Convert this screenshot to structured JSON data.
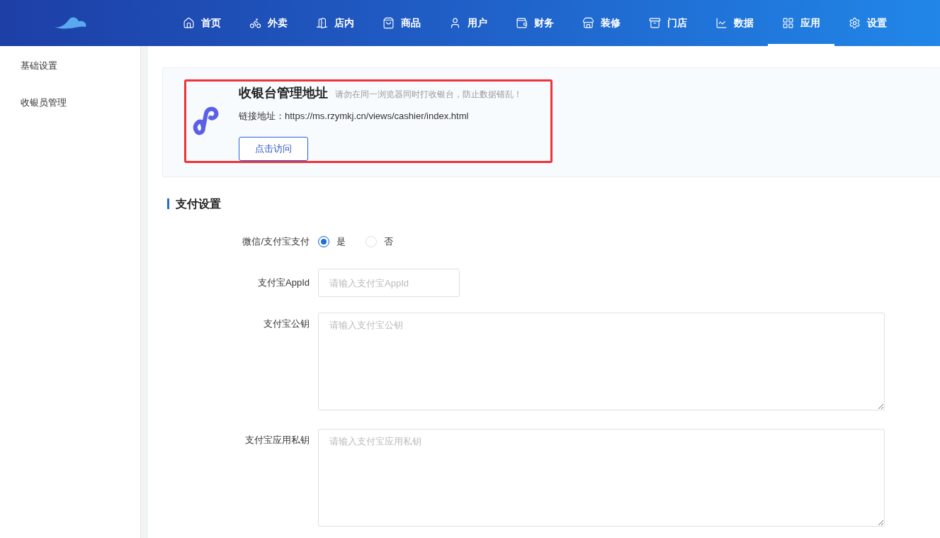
{
  "nav": [
    {
      "label": "首页",
      "selected": false
    },
    {
      "label": "外卖",
      "selected": false
    },
    {
      "label": "店内",
      "selected": false
    },
    {
      "label": "商品",
      "selected": false
    },
    {
      "label": "用户",
      "selected": false
    },
    {
      "label": "财务",
      "selected": false
    },
    {
      "label": "装修",
      "selected": false
    },
    {
      "label": "门店",
      "selected": false
    },
    {
      "label": "数据",
      "selected": false
    },
    {
      "label": "应用",
      "selected": true
    },
    {
      "label": "设置",
      "selected": false
    }
  ],
  "sidebar": {
    "items": [
      {
        "label": "基础设置",
        "selected": false
      },
      {
        "label": "收银员管理",
        "selected": false
      }
    ]
  },
  "cashier_card": {
    "title": "收银台管理地址",
    "notice": "请勿在同一浏览器同时打收银台，防止数据错乱！",
    "link_label": "链接地址：",
    "link_url": "https://ms.rzymkj.cn/views/cashier/index.html",
    "button": "点击访问"
  },
  "section_title": "支付设置",
  "fields": [
    {
      "kind": "radio",
      "label": "微信/支付宝支付",
      "options": [
        {
          "label": "是",
          "selected": true
        },
        {
          "label": "否",
          "selected": false
        }
      ]
    },
    {
      "kind": "input",
      "label": "支付宝AppId",
      "placeholder": "请输入支付宝AppId"
    },
    {
      "kind": "textarea",
      "label": "支付宝公钥",
      "placeholder": "请输入支付宝公钥"
    },
    {
      "kind": "textarea",
      "label": "支付宝应用私钥",
      "placeholder": "请输入支付宝应用私钥"
    }
  ]
}
